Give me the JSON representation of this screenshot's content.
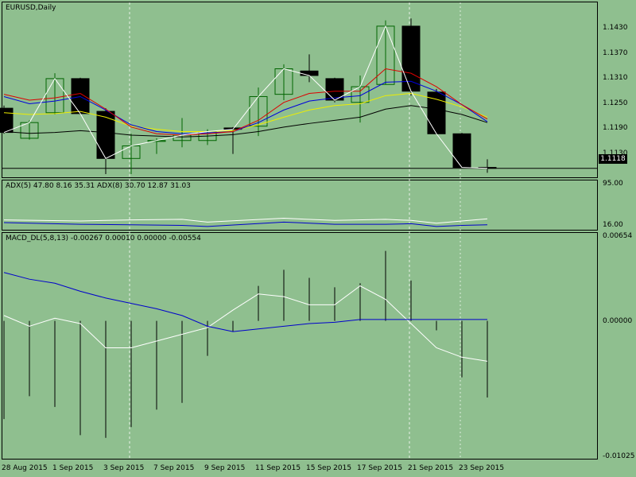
{
  "price_pane": {
    "title": "EURUSD,Daily",
    "current_price": "1.1118",
    "y_ticks": [
      "1.1430",
      "1.1370",
      "1.1310",
      "1.1250",
      "1.1190",
      "1.1130"
    ]
  },
  "adx_pane": {
    "title": "ADX(5) 47.80 8.16 35.31 ADX(8) 30.70 12.87 31.03",
    "y_ticks": [
      "95.00",
      "16.00"
    ]
  },
  "macd_pane": {
    "title": "MACD_DL(5,8,13) -0.00267 0.00010 0.00000 -0.00554",
    "y_ticks": [
      "0.00654",
      "0.00000",
      "-0.01025"
    ]
  },
  "x_ticks": [
    "28 Aug 2015",
    "1 Sep 2015",
    "3 Sep 2015",
    "7 Sep 2015",
    "9 Sep 2015",
    "11 Sep 2015",
    "15 Sep 2015",
    "17 Sep 2015",
    "21 Sep 2015",
    "23 Sep 2015"
  ],
  "colors": {
    "background": "#8fbf8f",
    "bull": "#006400",
    "bear": "#000000",
    "ma_fast": "#dd0000",
    "ma_mid": "#0000dd",
    "ma_slow": "#eeee00",
    "ma_long": "#000000",
    "line_white": "#ffffff",
    "macd_signal": "#0000cc"
  },
  "chart_data": [
    {
      "type": "candlestick",
      "title": "EURUSD,Daily",
      "ylim": [
        1.1098,
        1.1488
      ],
      "candles": [
        {
          "o": 1.1252,
          "h": 1.1258,
          "l": 1.1195,
          "c": 1.1198
        },
        {
          "o": 1.1185,
          "h": 1.1225,
          "l": 1.1182,
          "c": 1.122
        },
        {
          "o": 1.1242,
          "h": 1.133,
          "l": 1.1238,
          "c": 1.1318
        },
        {
          "o": 1.1318,
          "h": 1.132,
          "l": 1.1238,
          "c": 1.124
        },
        {
          "o": 1.1245,
          "h": 1.1252,
          "l": 1.1105,
          "c": 1.114
        },
        {
          "o": 1.114,
          "h": 1.1195,
          "l": 1.1105,
          "c": 1.1168
        },
        {
          "o": 1.1178,
          "h": 1.1185,
          "l": 1.115,
          "c": 1.118
        },
        {
          "o": 1.118,
          "h": 1.123,
          "l": 1.1165,
          "c": 1.1192
        },
        {
          "o": 1.118,
          "h": 1.1205,
          "l": 1.117,
          "c": 1.12
        },
        {
          "o": 1.1208,
          "h": 1.121,
          "l": 1.115,
          "c": 1.1205
        },
        {
          "o": 1.1212,
          "h": 1.1298,
          "l": 1.119,
          "c": 1.1278
        },
        {
          "o": 1.1283,
          "h": 1.135,
          "l": 1.127,
          "c": 1.134
        },
        {
          "o": 1.1335,
          "h": 1.1372,
          "l": 1.131,
          "c": 1.1325
        },
        {
          "o": 1.1318,
          "h": 1.132,
          "l": 1.1265,
          "c": 1.127
        },
        {
          "o": 1.1265,
          "h": 1.1325,
          "l": 1.122,
          "c": 1.13
        },
        {
          "o": 1.1305,
          "h": 1.1448,
          "l": 1.1305,
          "c": 1.1435
        },
        {
          "o": 1.1435,
          "h": 1.1452,
          "l": 1.128,
          "c": 1.129
        },
        {
          "o": 1.1288,
          "h": 1.1295,
          "l": 1.1195,
          "c": 1.1195
        },
        {
          "o": 1.1195,
          "h": 1.1197,
          "l": 1.1118,
          "c": 1.112
        },
        {
          "o": 1.112,
          "h": 1.1138,
          "l": 1.1108,
          "c": 1.1118
        }
      ],
      "ma_fast": [
        1.1283,
        1.127,
        1.1275,
        1.1285,
        1.125,
        1.121,
        1.1195,
        1.1192,
        1.1195,
        1.12,
        1.1225,
        1.1265,
        1.1285,
        1.129,
        1.129,
        1.134,
        1.133,
        1.13,
        1.126,
        1.1228
      ],
      "ma_mid": [
        1.1278,
        1.1262,
        1.1268,
        1.1278,
        1.1248,
        1.1215,
        1.12,
        1.1195,
        1.1197,
        1.12,
        1.122,
        1.1248,
        1.1268,
        1.1275,
        1.128,
        1.131,
        1.1312,
        1.129,
        1.126,
        1.1222
      ],
      "ma_slow": [
        1.1242,
        1.1238,
        1.124,
        1.1245,
        1.1232,
        1.1212,
        1.1205,
        1.12,
        1.12,
        1.1202,
        1.1215,
        1.1232,
        1.1248,
        1.1258,
        1.1262,
        1.128,
        1.1285,
        1.1272,
        1.1255,
        1.1232
      ],
      "ma_long": [
        1.12,
        1.1196,
        1.1198,
        1.1202,
        1.1198,
        1.1192,
        1.119,
        1.1188,
        1.119,
        1.1193,
        1.12,
        1.121,
        1.1218,
        1.1225,
        1.1232,
        1.125,
        1.1258,
        1.125,
        1.1238,
        1.122
      ],
      "close_line": [
        1.1198,
        1.122,
        1.1318,
        1.124,
        1.114,
        1.1168,
        1.118,
        1.1192,
        1.12,
        1.1205,
        1.1278,
        1.134,
        1.1325,
        1.127,
        1.13,
        1.1435,
        1.129,
        1.1195,
        1.112,
        1.1118
      ],
      "price_level": 1.1118
    },
    {
      "type": "line",
      "title": "ADX(5) 47.80 8.16 35.31 ADX(8) 30.70 12.87 31.03",
      "ylim": [
        10,
        100
      ],
      "white": [
        {
          "i": 0,
          "v": 28
        },
        {
          "i": 3,
          "v": 26
        },
        {
          "i": 5,
          "v": 28
        },
        {
          "i": 7,
          "v": 29
        },
        {
          "i": 8,
          "v": 24
        },
        {
          "i": 11,
          "v": 31
        },
        {
          "i": 13,
          "v": 27
        },
        {
          "i": 15,
          "v": 29
        },
        {
          "i": 16,
          "v": 27
        },
        {
          "i": 17,
          "v": 22
        },
        {
          "i": 19,
          "v": 30
        }
      ],
      "blue": [
        {
          "i": 0,
          "v": 23
        },
        {
          "i": 3,
          "v": 20
        },
        {
          "i": 5,
          "v": 19
        },
        {
          "i": 7,
          "v": 18
        },
        {
          "i": 8,
          "v": 16
        },
        {
          "i": 11,
          "v": 24
        },
        {
          "i": 13,
          "v": 20
        },
        {
          "i": 15,
          "v": 20
        },
        {
          "i": 16,
          "v": 21
        },
        {
          "i": 17,
          "v": 16
        },
        {
          "i": 18,
          "v": 18
        },
        {
          "i": 19,
          "v": 19
        }
      ]
    },
    {
      "type": "bar",
      "title": "MACD_DL(5,8,13) -0.00267 0.00010 0.00000 -0.00554",
      "ylim": [
        -0.01025,
        0.00654
      ],
      "histogram": [
        -0.0073,
        -0.0056,
        -0.0064,
        -0.0085,
        -0.0087,
        -0.0079,
        -0.0066,
        -0.0061,
        -0.0026,
        -0.0008,
        0.0026,
        0.0038,
        0.0032,
        0.0025,
        0.0028,
        0.0052,
        0.003,
        -0.0007,
        -0.0042,
        -0.0057
      ],
      "white": [
        0.0004,
        -0.0004,
        0.0002,
        -0.0002,
        -0.002,
        -0.002,
        -0.0015,
        -0.001,
        -0.0005,
        0.0008,
        0.002,
        0.0018,
        0.0012,
        0.0012,
        0.0026,
        0.0016,
        -0.0002,
        -0.002,
        -0.0027,
        -0.003
      ],
      "blue": [
        0.0036,
        0.0031,
        0.0028,
        0.0022,
        0.0017,
        0.0013,
        0.0009,
        0.0004,
        -0.0004,
        -0.0008,
        -0.0006,
        -0.0004,
        -0.0002,
        -0.0001,
        0.0001,
        0.0001,
        0.0001,
        0.0001,
        0.0001,
        0.0001
      ]
    }
  ]
}
